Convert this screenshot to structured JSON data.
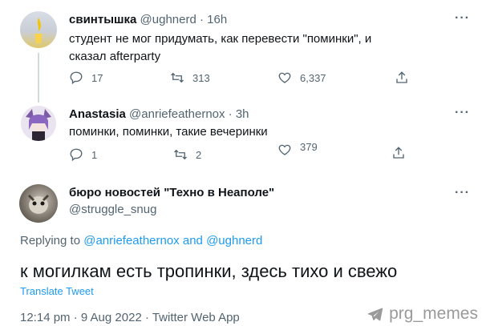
{
  "tweets": [
    {
      "name": "свинтышка",
      "handle": "@ughnerd · 16h",
      "text": "студент не мог придумать, как перевести \"поминки\", и сказал afterparty",
      "replies": "17",
      "retweets": "313",
      "likes": "6,337"
    },
    {
      "name": "Anastasia",
      "handle": "@anriefeathernox · 3h",
      "text": "поминки, поминки, такие вечеринки",
      "replies": "1",
      "retweets": "2",
      "likes": "379"
    }
  ],
  "main": {
    "name": "бюро новостей \"Техно в Неаполе\"",
    "handle": "@struggle_snug",
    "replying_prefix": "Replying to",
    "replying_user1": "@anriefeathernox",
    "replying_and": "and",
    "replying_user2": "@ughnerd",
    "text": "к могилкам есть тропинки, здесь тихо и свежо",
    "translate": "Translate Tweet",
    "meta": "12:14 pm · 9 Aug 2022 · Twitter Web App"
  },
  "more_label": "···",
  "watermark": "prg_memes",
  "colors": {
    "accent": "#1d9bf0",
    "muted": "#536471"
  },
  "icons": [
    "reply-icon",
    "retweet-icon",
    "like-icon",
    "share-icon",
    "telegram-icon"
  ]
}
